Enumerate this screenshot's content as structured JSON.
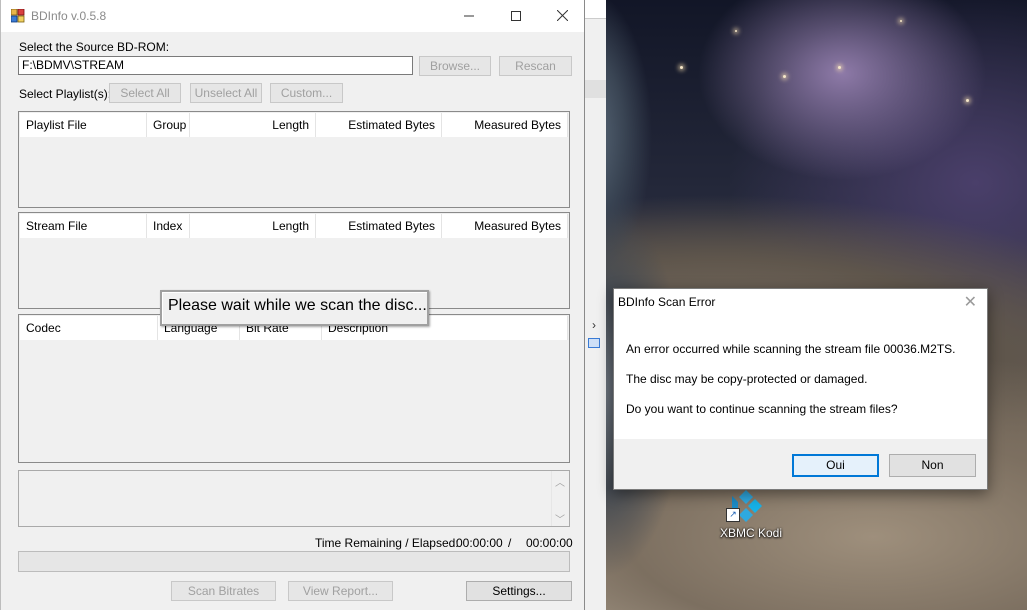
{
  "desktop": {
    "shortcut_label": "XBMC Kodi"
  },
  "main_window": {
    "title": "BDInfo v.0.5.8",
    "source_label": "Select the Source BD-ROM:",
    "source_value": "F:\\BDMV\\STREAM",
    "browse_label": "Browse...",
    "rescan_label": "Rescan",
    "playlist_label": "Select Playlist(s):",
    "select_all_label": "Select All",
    "unselect_all_label": "Unselect All",
    "custom_label": "Custom...",
    "playlist_columns": [
      "Playlist File",
      "Group",
      "Length",
      "Estimated Bytes",
      "Measured Bytes"
    ],
    "stream_columns": [
      "Stream File",
      "Index",
      "Length",
      "Estimated Bytes",
      "Measured Bytes"
    ],
    "codec_columns": [
      "Codec",
      "Language",
      "Bit Rate",
      "Description"
    ],
    "time_label": "Time Remaining / Elapsed:",
    "time_remaining": "00:00:00",
    "time_separator": "/",
    "time_elapsed": "00:00:00",
    "scan_bitrates_label": "Scan Bitrates",
    "view_report_label": "View Report...",
    "settings_label": "Settings...",
    "scan_message": "Please wait while we scan the disc..."
  },
  "error_dialog": {
    "title": "BDInfo Scan Error",
    "line1": "An error occurred while scanning the stream file 00036.M2TS.",
    "line2": "The disc may be copy-protected or damaged.",
    "line3": "Do you want to continue scanning the stream files?",
    "yes_label": "Oui",
    "no_label": "Non"
  },
  "colors": {
    "accent": "#0078d7",
    "window_bg": "#f0f0f0",
    "disabled_text": "#a0a0a0"
  }
}
